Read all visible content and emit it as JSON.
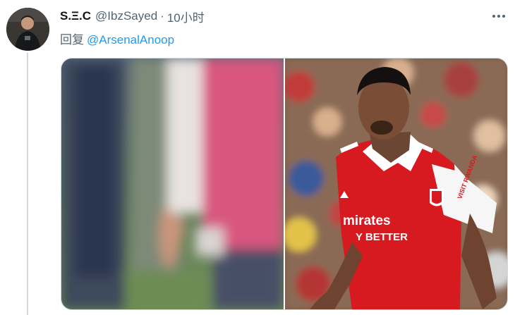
{
  "tweet": {
    "display_name": "S.Ξ.C",
    "handle": "@IbzSayed",
    "separator": "·",
    "time": "10小时",
    "reply_prefix": "回复",
    "reply_mention": "@ArsenalAnoop",
    "more_icon": "more-icon"
  },
  "media": {
    "photos": [
      {
        "name": "blurred-close-up-photo",
        "kit_text": ""
      },
      {
        "name": "player-photo",
        "kit_sponsor_line1": "mirates",
        "kit_sponsor_line2": "Y BETTER",
        "sleeve_text": "VISIT RWANDA"
      }
    ]
  },
  "colors": {
    "link": "#1d9bf0",
    "secondary_text": "#536471",
    "kit_red": "#d71920",
    "thread_line": "#cfd9de"
  }
}
